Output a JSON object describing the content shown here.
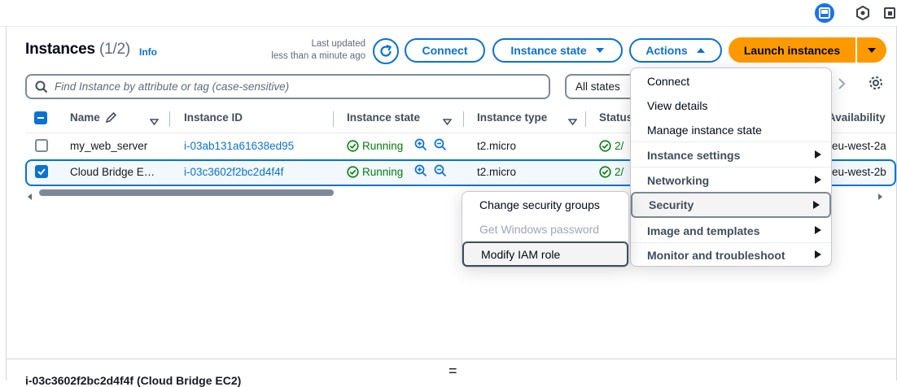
{
  "header": {
    "title": "Instances",
    "count": "(1/2)",
    "info": "Info",
    "last_updated_line1": "Last updated",
    "last_updated_line2": "less than a minute ago"
  },
  "toolbar": {
    "connect": "Connect",
    "instance_state": "Instance state",
    "actions": "Actions",
    "launch": "Launch instances"
  },
  "filter": {
    "search_placeholder": "Find Instance by attribute or tag (case-sensitive)",
    "states": "All states"
  },
  "table": {
    "columns": {
      "name": "Name",
      "instance_id": "Instance ID",
      "instance_state": "Instance state",
      "instance_type": "Instance type",
      "status": "Status",
      "availability": "Availability"
    },
    "rows": [
      {
        "name": "my_web_server",
        "id": "i-03ab131a61638ed95",
        "state": "Running",
        "type": "t2.micro",
        "status": "2/",
        "az": "eu-west-2a",
        "selected": false
      },
      {
        "name": "Cloud Bridge E…",
        "id": "i-03c3602f2bc2d4f4f",
        "state": "Running",
        "type": "t2.micro",
        "status": "2/",
        "az": "eu-west-2b",
        "selected": true
      }
    ]
  },
  "actions_menu": {
    "connect": "Connect",
    "view_details": "View details",
    "manage_state": "Manage instance state",
    "instance_settings": "Instance settings",
    "networking": "Networking",
    "security": "Security",
    "image_templates": "Image and templates",
    "monitor": "Monitor and troubleshoot"
  },
  "security_submenu": {
    "change_sg": "Change security groups",
    "get_password": "Get Windows password",
    "modify_iam": "Modify IAM role"
  },
  "bottom_panel": {
    "handle": "=",
    "peek": "i-03c3602f2bc2d4f4f (Cloud Bridge EC2)"
  },
  "colors": {
    "accent": "#0972d3",
    "launch": "#ff9900",
    "running": "#037f0c"
  }
}
